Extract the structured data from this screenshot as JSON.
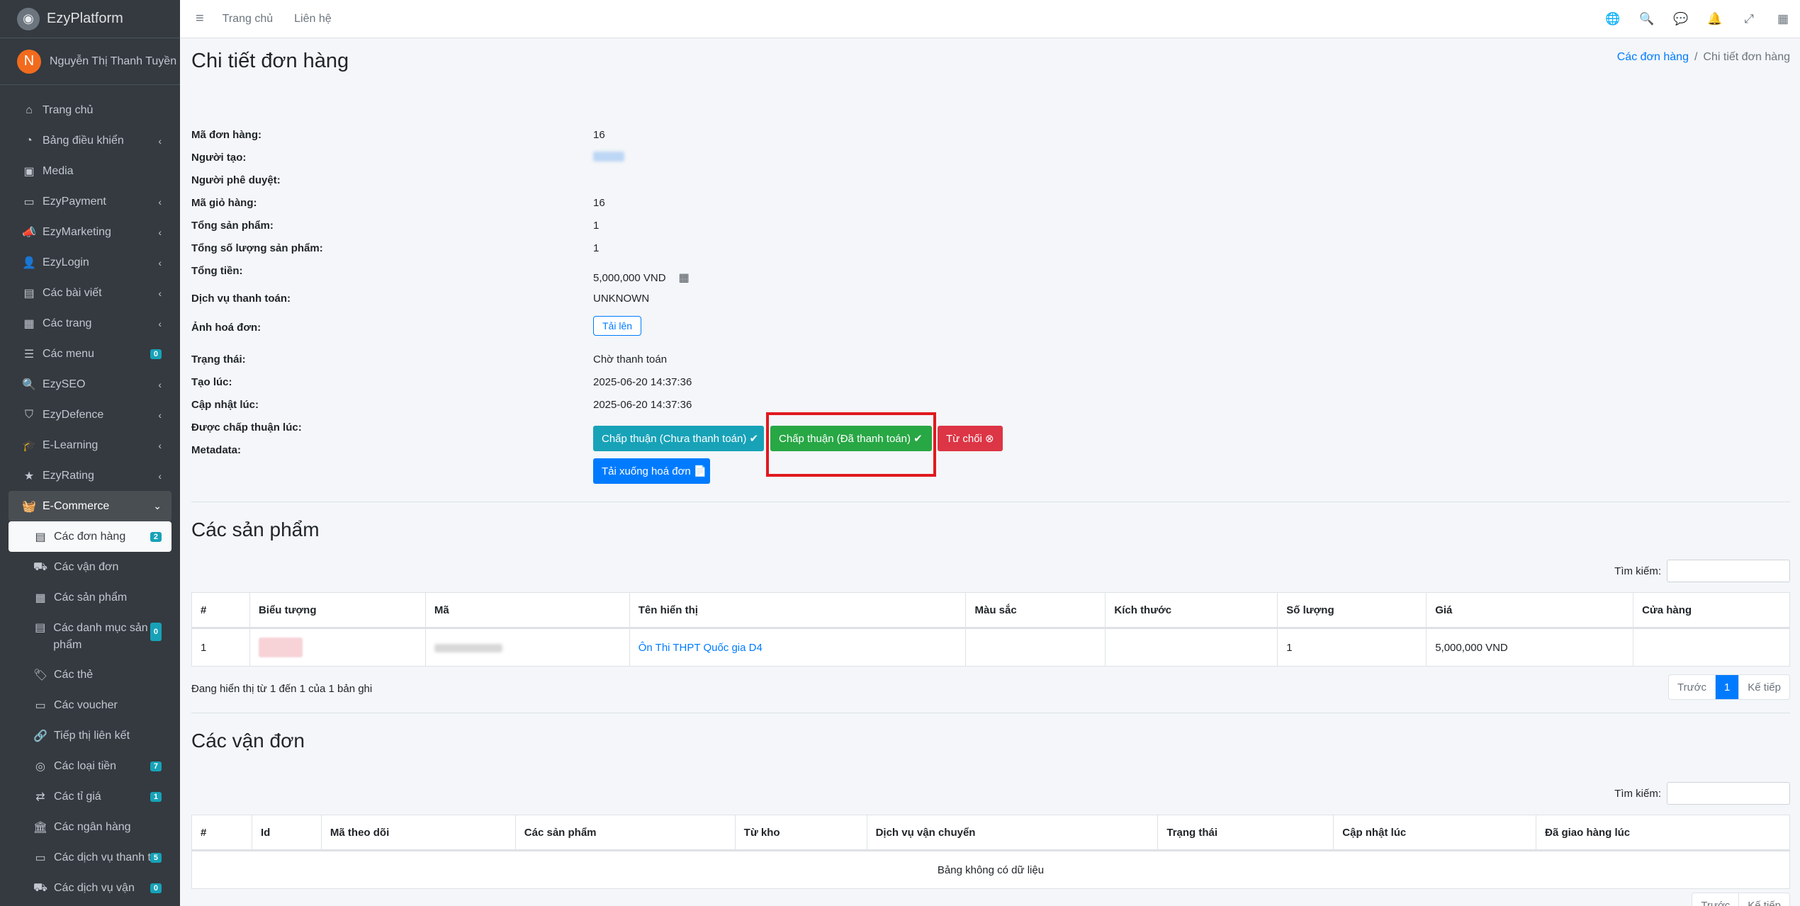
{
  "brand": {
    "name": "EzyPlatform",
    "logo_icon": "ezyplatform-logo-icon"
  },
  "user": {
    "initial": "N",
    "name": "Nguyễn Thị Thanh Tuyền",
    "avatar_color": "#f26b1d"
  },
  "sidebar": {
    "items": [
      {
        "label": "Trang chủ",
        "icon": "⌂"
      },
      {
        "label": "Bảng điều khiển",
        "icon": "◔",
        "arrow": "‹"
      },
      {
        "label": "Media",
        "icon": "▣"
      },
      {
        "label": "EzyPayment",
        "icon": "▭",
        "arrow": "‹"
      },
      {
        "label": "EzyMarketing",
        "icon": "📣",
        "arrow": "‹"
      },
      {
        "label": "EzyLogin",
        "icon": "👤",
        "arrow": "‹"
      },
      {
        "label": "Các bài viết",
        "icon": "▤",
        "arrow": "‹"
      },
      {
        "label": "Các trang",
        "icon": "▦",
        "arrow": "‹"
      },
      {
        "label": "Các menu",
        "icon": "☰",
        "badge": "0"
      },
      {
        "label": "EzySEO",
        "icon": "🔍",
        "arrow": "‹"
      },
      {
        "label": "EzyDefence",
        "icon": "⛉",
        "arrow": "‹"
      },
      {
        "label": "E-Learning",
        "icon": "🎓",
        "arrow": "‹"
      },
      {
        "label": "EzyRating",
        "icon": "★",
        "arrow": "‹"
      }
    ],
    "ecommerce": {
      "label": "E-Commerce",
      "icon": "🧺",
      "arrow": "⌄"
    },
    "sub_items": [
      {
        "label": "Các đơn hàng",
        "icon": "▤",
        "badge": "2"
      },
      {
        "label": "Các vận đơn",
        "icon": "⛟"
      },
      {
        "label": "Các sản phẩm",
        "icon": "▦"
      },
      {
        "label": "Các danh mục sản phẩm",
        "icon": "▤",
        "badge": "0"
      },
      {
        "label": "Các thẻ",
        "icon": "🏷"
      },
      {
        "label": "Các voucher",
        "icon": "▭"
      },
      {
        "label": "Tiếp thị liên kết",
        "icon": "🔗"
      },
      {
        "label": "Các loại tiền",
        "icon": "◎",
        "badge": "7"
      },
      {
        "label": "Các tỉ giá",
        "icon": "⇄",
        "badge": "1"
      },
      {
        "label": "Các ngân hàng",
        "icon": "🏛"
      },
      {
        "label": "Các dịch vụ thanh toán",
        "icon": "▭",
        "badge": "5"
      },
      {
        "label": "Các dịch vụ vận",
        "icon": "⛟",
        "badge": "0"
      }
    ],
    "badge_color": "#17a2b8"
  },
  "topnav": {
    "menu_icon": "≡",
    "links": [
      "Trang chủ",
      "Liên hệ"
    ],
    "icons": [
      {
        "name": "globe-icon",
        "glyph": "🌐"
      },
      {
        "name": "search-icon",
        "glyph": "🔍"
      },
      {
        "name": "messages-icon",
        "glyph": "💬"
      },
      {
        "name": "notifications-icon",
        "glyph": "🔔"
      },
      {
        "name": "fullscreen-icon",
        "glyph": "⤢"
      },
      {
        "name": "apps-icon",
        "glyph": "▦"
      }
    ]
  },
  "page": {
    "title": "Chi tiết đơn hàng",
    "breadcrumb": {
      "parent": "Các đơn hàng",
      "separator": "/",
      "current": "Chi tiết đơn hàng"
    }
  },
  "order": {
    "rows": [
      {
        "label": "Mã đơn hàng:",
        "value": "16"
      },
      {
        "label": "Người tạo:",
        "value": ""
      },
      {
        "label": "Người phê duyệt:",
        "value": ""
      },
      {
        "label": "Mã giỏ hàng:",
        "value": "16"
      },
      {
        "label": "Tổng sản phẩm:",
        "value": "1"
      },
      {
        "label": "Tổng số lượng sản phẩm:",
        "value": "1"
      },
      {
        "label": "Tổng tiền:",
        "value": "5,000,000 VND"
      },
      {
        "label": "Dịch vụ thanh toán:",
        "value": "UNKNOWN"
      },
      {
        "label": "Ảnh hoá đơn:",
        "value": ""
      },
      {
        "label": "Trạng thái:",
        "value": "Chờ thanh toán"
      },
      {
        "label": "Tạo lúc:",
        "value": "2025-06-20 14:37:36"
      },
      {
        "label": "Cập nhật lúc:",
        "value": "2025-06-20 14:37:36"
      },
      {
        "label": "Được chấp thuận lúc:",
        "value": ""
      },
      {
        "label": "Metadata:",
        "value": ""
      }
    ],
    "upload_label": "Tải lên",
    "qr_icon": "▦"
  },
  "actions": {
    "approve_unpaid": "Chấp thuận (Chưa thanh toán) ✔",
    "approve_paid": "Chấp thuận (Đã thanh toán) ✔",
    "reject": "Từ chối ⊗",
    "download_invoice": "Tải xuống hoá đơn 📄",
    "colors": {
      "info": "#17a2b8",
      "success": "#28a745",
      "danger": "#dc3545",
      "primary": "#007bff",
      "highlight": "#e0191f"
    }
  },
  "products": {
    "title": "Các sản phẩm",
    "search_label": "Tìm kiếm:",
    "columns": [
      "#",
      "Biểu tượng",
      "Mã",
      "Tên hiển thị",
      "Màu sắc",
      "Kích thước",
      "Số lượng",
      "Giá",
      "Cửa hàng"
    ],
    "rows": [
      {
        "index": "1",
        "name": "Ôn Thi THPT Quốc gia D4",
        "color": "",
        "size": "",
        "quantity": "1",
        "price": "5,000,000 VND",
        "store": ""
      }
    ],
    "info": "Đang hiển thị từ 1 đến 1 của 1 bản ghi",
    "pagination": {
      "prev": "Trước",
      "current": "1",
      "next": "Kế tiếp"
    }
  },
  "shipments": {
    "title": "Các vận đơn",
    "search_label": "Tìm kiếm:",
    "columns": [
      "#",
      "Id",
      "Mã theo dõi",
      "Các sản phẩm",
      "Từ kho",
      "Dịch vụ vận chuyển",
      "Trạng thái",
      "Cập nhật lúc",
      "Đã giao hàng lúc"
    ],
    "empty": "Bảng không có dữ liệu",
    "pagination": {
      "prev": "Trước",
      "next": "Kế tiếp"
    }
  }
}
